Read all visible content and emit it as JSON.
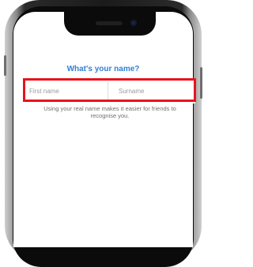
{
  "form": {
    "title": "What's your name?",
    "first_name_placeholder": "First name",
    "first_name_value": "",
    "surname_placeholder": "Surname",
    "surname_value": "",
    "hint": "Using your real name makes it easier for friends to recognise you."
  },
  "colors": {
    "title": "#2f7fd9",
    "highlight": "#e8131b",
    "placeholder": "#9a9a9a",
    "hint": "#6e6e6e"
  },
  "icons": {
    "camera": "front-camera-icon",
    "speaker": "earpiece-speaker-icon"
  }
}
